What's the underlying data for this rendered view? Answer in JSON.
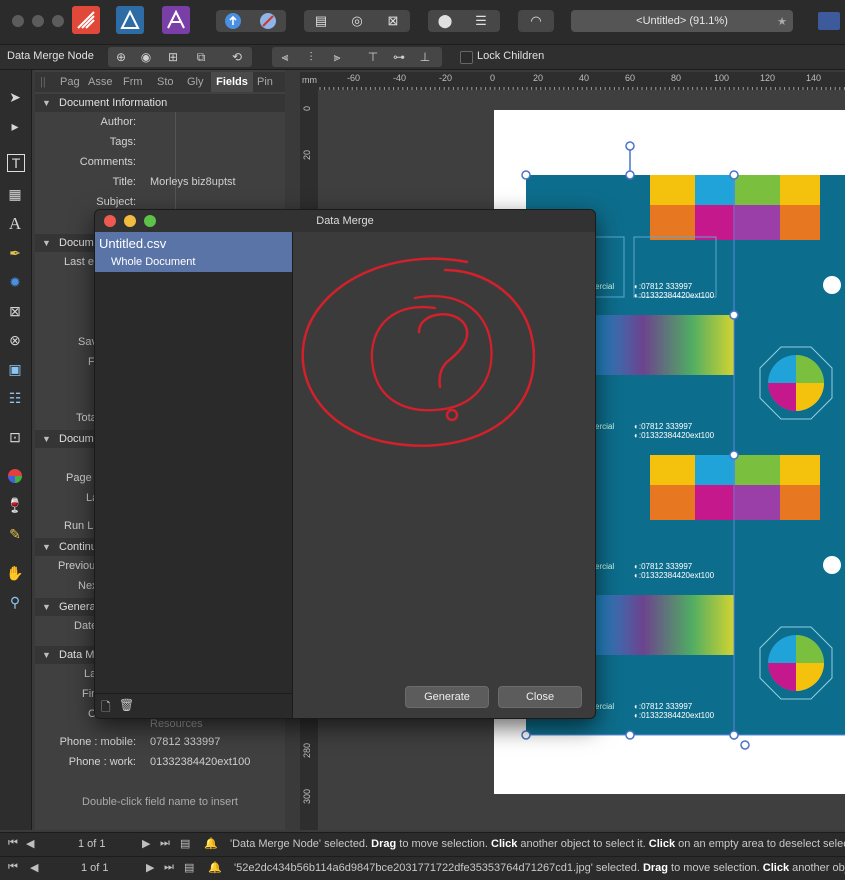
{
  "window": {
    "doc_title": "<Untitled> (91.1%)",
    "doc_star": "★"
  },
  "context_toolbar": {
    "node_label": "Data Merge Node",
    "lock_children_label": "Lock Children"
  },
  "studio": {
    "tabs": [
      "Pag",
      "Asse",
      "Frm",
      "Sto",
      "Gly",
      "Fields",
      "Pin"
    ],
    "active_tab": "Fields",
    "sections": {
      "document_information": "Document Information",
      "document_2": "Docume",
      "document_3": "Docume",
      "continue": "Continu",
      "general": "Genera",
      "data_merge": "Data M"
    },
    "doc_info_fields": [
      {
        "label": "Author:",
        "value": ""
      },
      {
        "label": "Tags:",
        "value": ""
      },
      {
        "label": "Comments:",
        "value": ""
      },
      {
        "label": "Title:",
        "value": "Morleys biz8uptst"
      },
      {
        "label": "Subject:",
        "value": ""
      }
    ],
    "partial_labels": {
      "last_e": "Last e",
      "sav": "Sav",
      "f": "F",
      "tota": "Tota",
      "page": "Page",
      "la1": "La",
      "run_la": "Run La",
      "previous": "Previou",
      "nex": "Nex",
      "date": "Date",
      "la2": "La",
      "fir": "Fir",
      "c": "C"
    },
    "merge_fields": [
      {
        "label": "",
        "value": "Resources"
      },
      {
        "label": "Phone : mobile:",
        "value": "07812 333997"
      },
      {
        "label": "Phone : work:",
        "value": "01332384420ext100"
      }
    ],
    "hint": "Double-click field name to insert"
  },
  "ruler": {
    "unit": "mm",
    "top_ticks": [
      "-60",
      "-40",
      "-20",
      "0",
      "20",
      "40",
      "60",
      "80",
      "100",
      "120",
      "140"
    ],
    "left_ticks": [
      "0",
      "20",
      "280",
      "300"
    ]
  },
  "cards": {
    "mobile": "07812 333997",
    "work": "01332384420ext100",
    "partial": "ercial"
  },
  "dialog": {
    "title": "Data Merge",
    "source_file": "Untitled.csv",
    "scope": "Whole Document",
    "generate_label": "Generate",
    "close_label": "Close"
  },
  "status": {
    "page_count_1": "1 of 1",
    "message_1_quote": "'Data Merge Node' selected. ",
    "drag": "Drag",
    "to_move": " to move selection. ",
    "click": "Click",
    "another": " another object to select it. ",
    "click2": "Click",
    "on_empty": " on an empty area to deselect selec",
    "page_count_2": "1 of 1",
    "message_2_quote": "'52e2dc434b56b114a6d9847bce2031771722dfe35353764d71267cd1.jpg' selected. ",
    "drag2": "Drag",
    "to_move2": " to move selection. ",
    "click3": "Click",
    "another2": " another obj"
  },
  "colors": {
    "card_teal": "#0d6d8c",
    "selection_blue": "#5a74a8",
    "annotation_red": "#d4202a"
  }
}
